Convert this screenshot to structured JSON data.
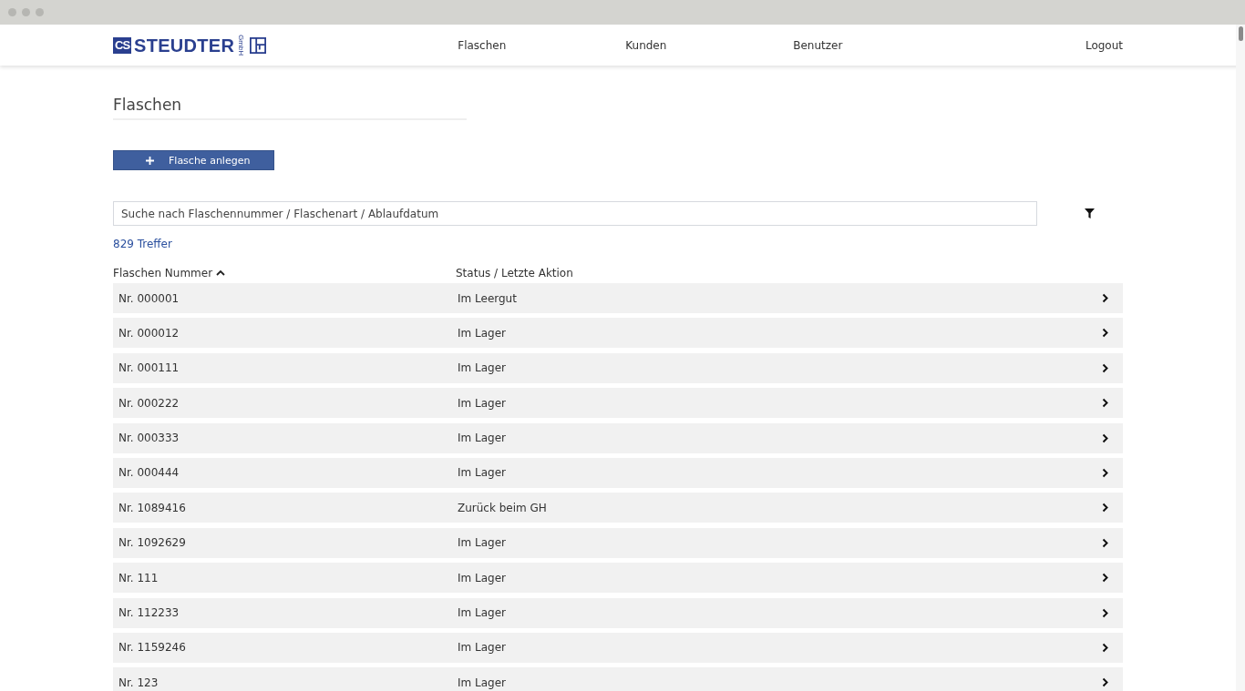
{
  "logo": {
    "badge": "CS",
    "name": "STEUDTER",
    "suffix": "GmbH"
  },
  "nav": [
    {
      "label": "Flaschen"
    },
    {
      "label": "Kunden"
    },
    {
      "label": "Benutzer"
    },
    {
      "label": "Logout"
    }
  ],
  "page_title": "Flaschen",
  "add_button": "Flasche anlegen",
  "search": {
    "placeholder": "Suche nach Flaschennummer / Flaschenart / Ablaufdatum"
  },
  "result_count": "829 Treffer",
  "table": {
    "columns": [
      {
        "label": "Flaschen Nummer",
        "sorted": true
      },
      {
        "label": "Status / Letzte Aktion",
        "sorted": false
      }
    ],
    "rows": [
      {
        "number": "Nr. 000001",
        "status": "Im Leergut"
      },
      {
        "number": "Nr. 000012",
        "status": "Im Lager"
      },
      {
        "number": "Nr. 000111",
        "status": "Im Lager"
      },
      {
        "number": "Nr. 000222",
        "status": "Im Lager"
      },
      {
        "number": "Nr. 000333",
        "status": "Im Lager"
      },
      {
        "number": "Nr. 000444",
        "status": "Im Lager"
      },
      {
        "number": "Nr. 1089416",
        "status": "Zurück beim GH"
      },
      {
        "number": "Nr. 1092629",
        "status": "Im Lager"
      },
      {
        "number": "Nr. 111",
        "status": "Im Lager"
      },
      {
        "number": "Nr. 112233",
        "status": "Im Lager"
      },
      {
        "number": "Nr. 1159246",
        "status": "Im Lager"
      },
      {
        "number": "Nr. 123",
        "status": "Im Lager"
      }
    ]
  }
}
